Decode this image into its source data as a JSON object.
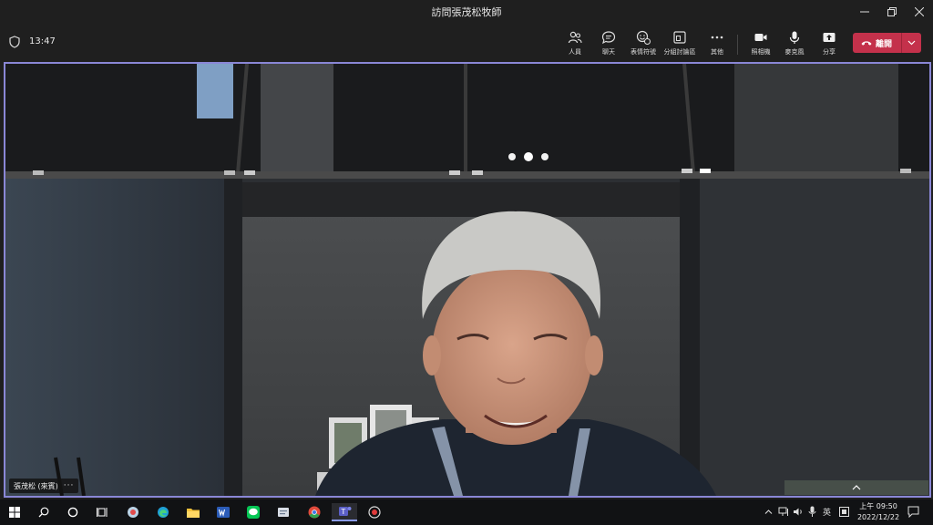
{
  "window": {
    "title": "訪問張茂松牧師"
  },
  "meeting": {
    "timer": "13:47",
    "controls": [
      {
        "id": "people",
        "label": "人員",
        "icon": "people-icon"
      },
      {
        "id": "chat",
        "label": "聊天",
        "icon": "chat-icon"
      },
      {
        "id": "reactions",
        "label": "表情符號",
        "icon": "reactions-icon"
      },
      {
        "id": "rooms",
        "label": "分組討論區",
        "icon": "breakout-rooms-icon"
      },
      {
        "id": "more",
        "label": "其他",
        "icon": "more-icon"
      },
      {
        "id": "camera",
        "label": "照相機",
        "icon": "camera-icon"
      },
      {
        "id": "mic",
        "label": "麥克風",
        "icon": "mic-icon"
      },
      {
        "id": "share",
        "label": "分享",
        "icon": "share-icon"
      }
    ],
    "leave_label": "離開",
    "participant_name": "張茂松 (來賓)",
    "participant_more": "···"
  },
  "taskbar": {
    "ime": "英",
    "time": "上午 09:50",
    "date": "2022/12/22"
  },
  "colors": {
    "accent": "#8a87d6",
    "leave": "#c4314b",
    "titlebar": "#1f1f1f"
  }
}
